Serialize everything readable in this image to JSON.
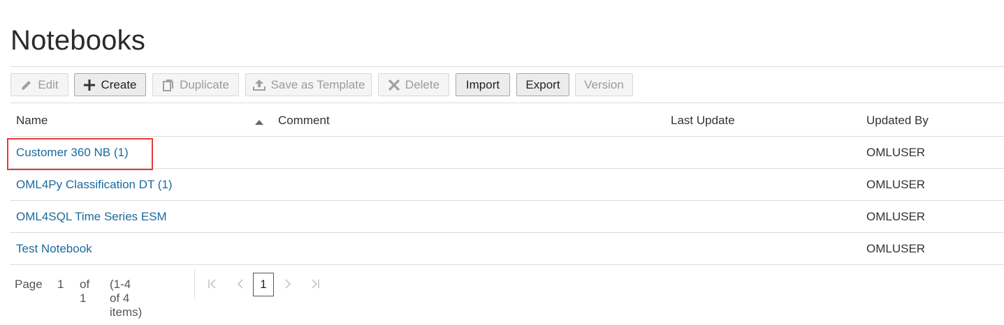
{
  "page": {
    "title": "Notebooks"
  },
  "toolbar": {
    "edit": "Edit",
    "create": "Create",
    "duplicate": "Duplicate",
    "save_as_template": "Save as Template",
    "delete": "Delete",
    "import": "Import",
    "export": "Export",
    "version": "Version"
  },
  "table": {
    "columns": {
      "name": "Name",
      "comment": "Comment",
      "last_update": "Last Update",
      "updated_by": "Updated By"
    },
    "sort": {
      "column": "Name",
      "direction": "ascending"
    },
    "rows": [
      {
        "name": "Customer 360 NB (1)",
        "comment": "",
        "last_update": "",
        "updated_by": "OMLUSER"
      },
      {
        "name": "OML4Py Classification DT (1)",
        "comment": "",
        "last_update": "",
        "updated_by": "OMLUSER"
      },
      {
        "name": "OML4SQL Time Series ESM",
        "comment": "",
        "last_update": "",
        "updated_by": "OMLUSER"
      },
      {
        "name": "Test Notebook",
        "comment": "",
        "last_update": "",
        "updated_by": "OMLUSER"
      }
    ]
  },
  "pager": {
    "page_label": "Page",
    "page_value": "1",
    "of_label": "of 1",
    "range": "(1-4 of 4 items)",
    "current": "1"
  },
  "colors": {
    "link": "#1a6a9e",
    "highlight": "#e8393b",
    "disabled_text": "#9b9b9b"
  }
}
